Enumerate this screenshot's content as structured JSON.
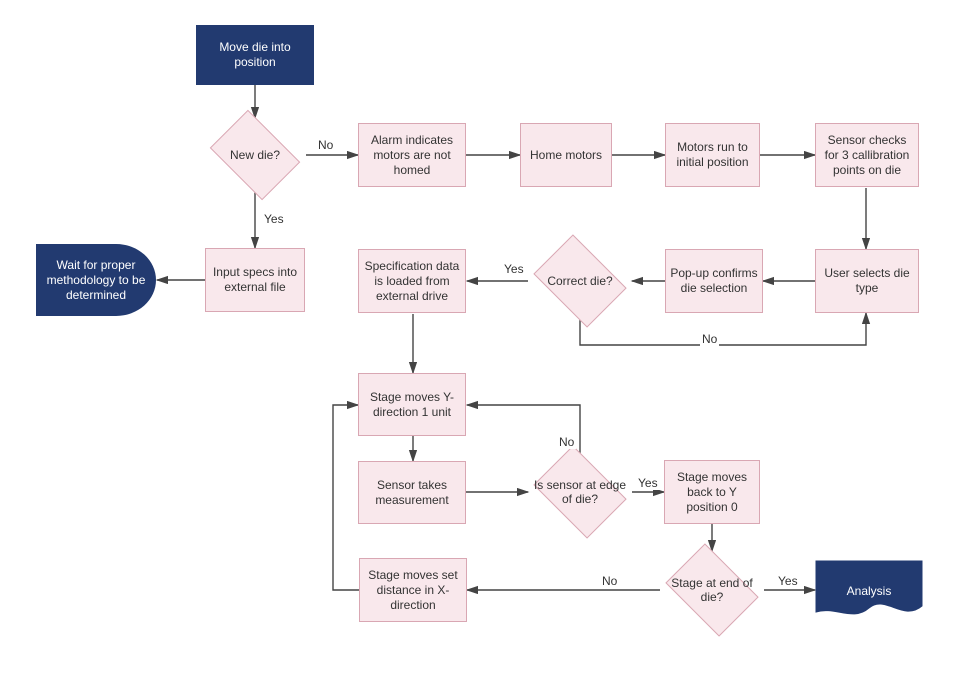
{
  "nodes": {
    "start": "Move die into position",
    "new_die": "New die?",
    "alarm": "Alarm indicates motors are not homed",
    "home_motors": "Home motors",
    "motors_initial": "Motors run to initial position",
    "sensor_3cal": "Sensor checks for 3 callibration points on die",
    "user_selects": "User selects die type",
    "popup_confirm": "Pop-up confirms die selection",
    "correct_die": "Correct die?",
    "spec_loaded": "Specification data is loaded from external drive",
    "input_specs": "Input specs into external file",
    "wait_method": "Wait for proper methodology to be determined",
    "stage_y1": "Stage moves Y-direction 1 unit",
    "sensor_meas": "Sensor takes measurement",
    "sensor_edge": "Is sensor at edge of die?",
    "stage_back_y0": "Stage moves back to Y position 0",
    "stage_end": "Stage at end of die?",
    "stage_x": "Stage moves set distance in X-direction",
    "analysis": "Analysis"
  },
  "edge_labels": {
    "new_die_no": "No",
    "new_die_yes": "Yes",
    "correct_die_yes": "Yes",
    "correct_die_no": "No",
    "sensor_edge_no": "No",
    "sensor_edge_yes": "Yes",
    "stage_end_no": "No",
    "stage_end_yes": "Yes"
  },
  "chart_data": {
    "type": "flowchart",
    "nodes": [
      {
        "id": "start",
        "type": "start",
        "label": "Move die into position"
      },
      {
        "id": "new_die",
        "type": "decision",
        "label": "New die?"
      },
      {
        "id": "alarm",
        "type": "process",
        "label": "Alarm indicates motors are not homed"
      },
      {
        "id": "home_motors",
        "type": "process",
        "label": "Home motors"
      },
      {
        "id": "motors_initial",
        "type": "process",
        "label": "Motors run to initial position"
      },
      {
        "id": "sensor_3cal",
        "type": "process",
        "label": "Sensor checks for 3 callibration points on die"
      },
      {
        "id": "user_selects",
        "type": "process",
        "label": "User selects die type"
      },
      {
        "id": "popup_confirm",
        "type": "process",
        "label": "Pop-up confirms die selection"
      },
      {
        "id": "correct_die",
        "type": "decision",
        "label": "Correct die?"
      },
      {
        "id": "spec_loaded",
        "type": "process",
        "label": "Specification data is loaded from external drive"
      },
      {
        "id": "input_specs",
        "type": "process",
        "label": "Input specs into external file"
      },
      {
        "id": "wait_method",
        "type": "terminator",
        "label": "Wait for proper methodology to be determined"
      },
      {
        "id": "stage_y1",
        "type": "process",
        "label": "Stage moves Y-direction 1 unit"
      },
      {
        "id": "sensor_meas",
        "type": "process",
        "label": "Sensor takes measurement"
      },
      {
        "id": "sensor_edge",
        "type": "decision",
        "label": "Is sensor at edge of die?"
      },
      {
        "id": "stage_back_y0",
        "type": "process",
        "label": "Stage moves back to Y position 0"
      },
      {
        "id": "stage_end",
        "type": "decision",
        "label": "Stage at end of die?"
      },
      {
        "id": "stage_x",
        "type": "process",
        "label": "Stage moves set distance in X-direction"
      },
      {
        "id": "analysis",
        "type": "document",
        "label": "Analysis"
      }
    ],
    "edges": [
      {
        "from": "start",
        "to": "new_die"
      },
      {
        "from": "new_die",
        "to": "alarm",
        "label": "No"
      },
      {
        "from": "new_die",
        "to": "input_specs",
        "label": "Yes"
      },
      {
        "from": "input_specs",
        "to": "wait_method"
      },
      {
        "from": "alarm",
        "to": "home_motors"
      },
      {
        "from": "home_motors",
        "to": "motors_initial"
      },
      {
        "from": "motors_initial",
        "to": "sensor_3cal"
      },
      {
        "from": "sensor_3cal",
        "to": "user_selects"
      },
      {
        "from": "user_selects",
        "to": "popup_confirm"
      },
      {
        "from": "popup_confirm",
        "to": "correct_die"
      },
      {
        "from": "correct_die",
        "to": "spec_loaded",
        "label": "Yes"
      },
      {
        "from": "correct_die",
        "to": "user_selects",
        "label": "No"
      },
      {
        "from": "spec_loaded",
        "to": "stage_y1"
      },
      {
        "from": "stage_y1",
        "to": "sensor_meas"
      },
      {
        "from": "sensor_meas",
        "to": "sensor_edge"
      },
      {
        "from": "sensor_edge",
        "to": "stage_y1",
        "label": "No"
      },
      {
        "from": "sensor_edge",
        "to": "stage_back_y0",
        "label": "Yes"
      },
      {
        "from": "stage_back_y0",
        "to": "stage_end"
      },
      {
        "from": "stage_end",
        "to": "stage_x",
        "label": "No"
      },
      {
        "from": "stage_end",
        "to": "analysis",
        "label": "Yes"
      },
      {
        "from": "stage_x",
        "to": "stage_y1"
      }
    ]
  }
}
